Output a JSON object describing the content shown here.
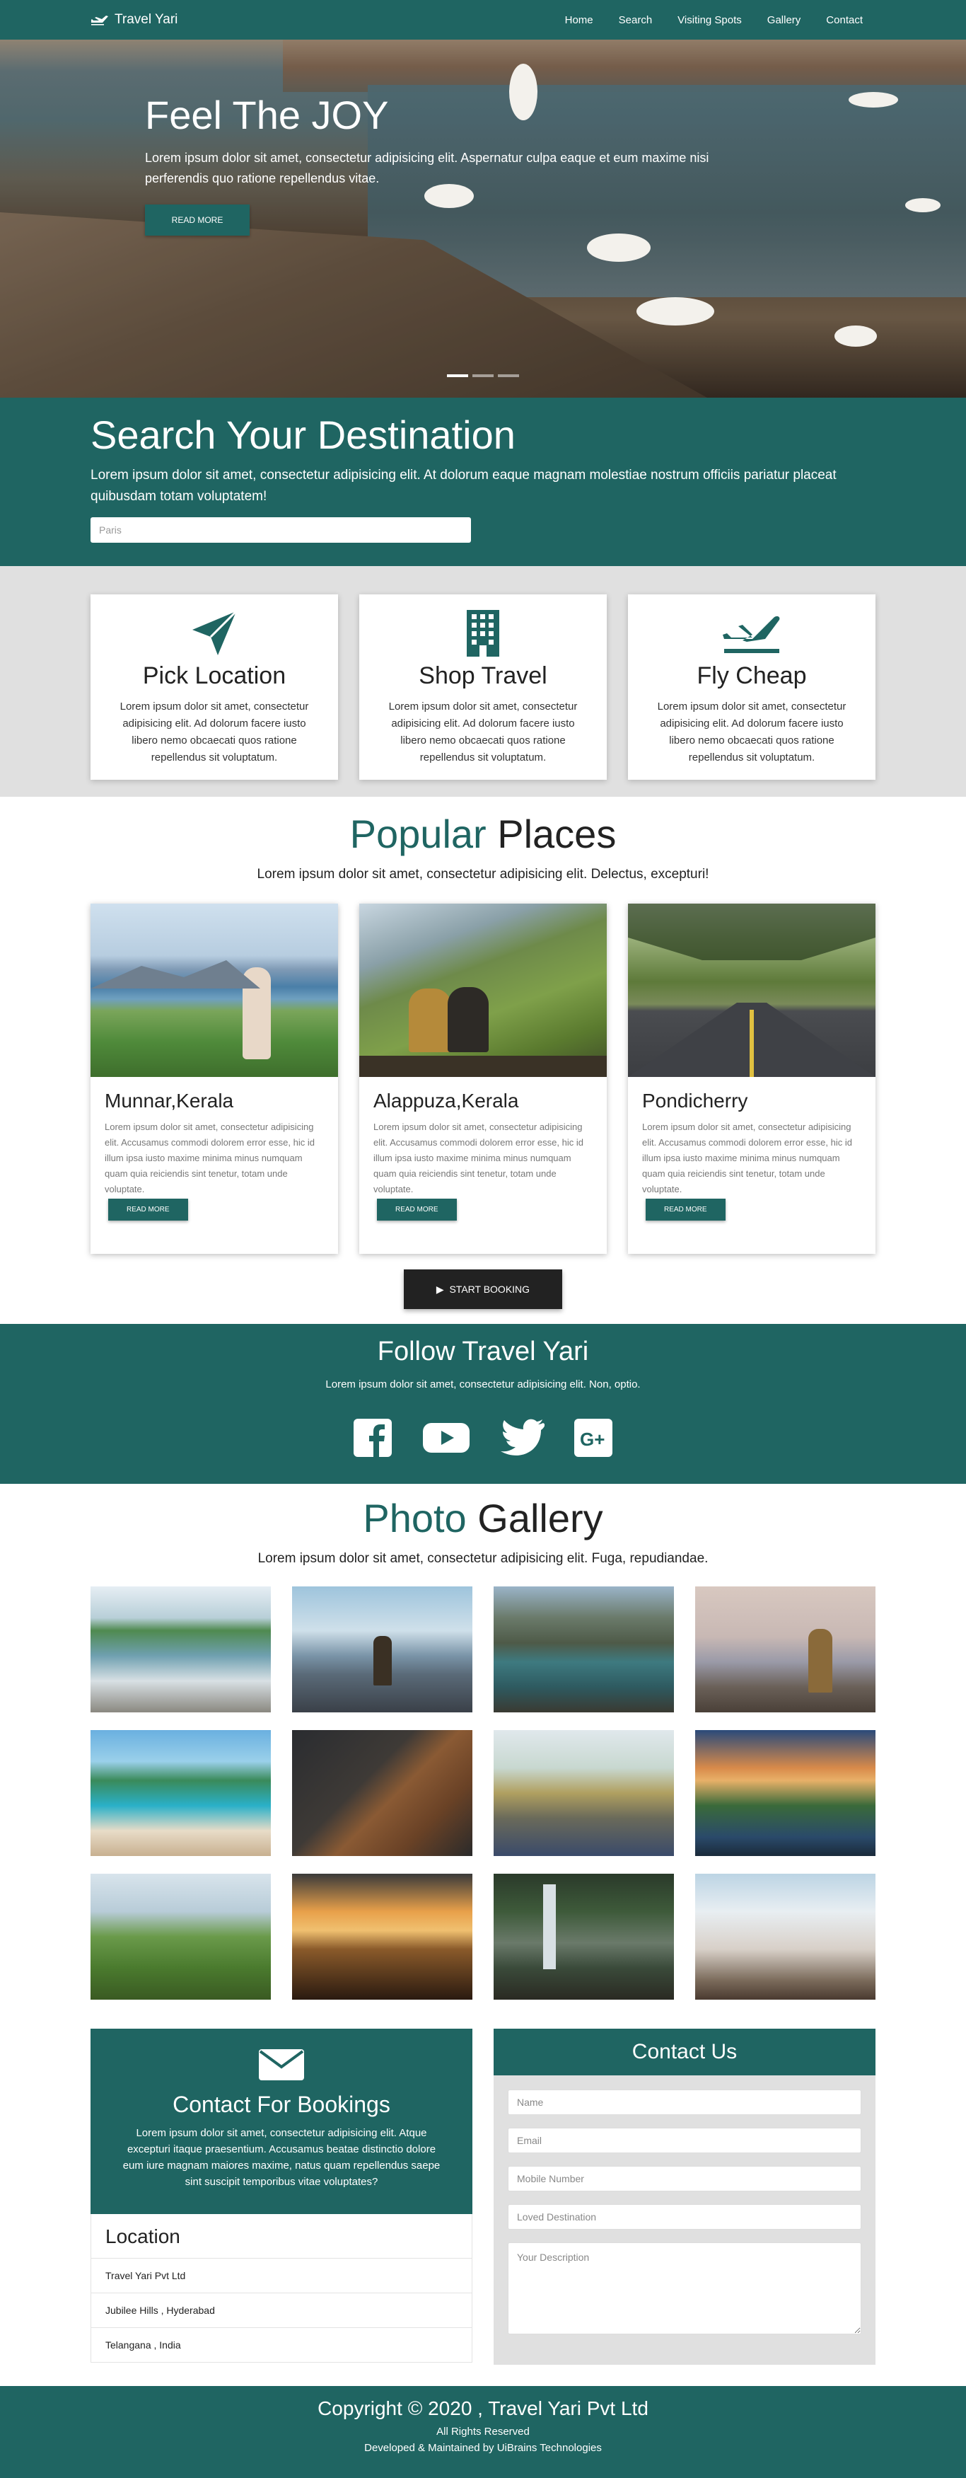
{
  "nav": {
    "brand": "Travel Yari",
    "items": [
      "Home",
      "Search",
      "Visiting Spots",
      "Gallery",
      "Contact"
    ]
  },
  "hero": {
    "title": "Feel The JOY",
    "text": "Lorem ipsum dolor sit amet, consectetur adipisicing elit. Aspernatur culpa eaque et eum maxime nisi perferendis quo ratione repellendus vitae.",
    "button": "READ MORE"
  },
  "search": {
    "title": "Search Your Destination",
    "text": "Lorem ipsum dolor sit amet, consectetur adipisicing elit. At dolorum eaque magnam molestiae nostrum officiis pariatur placeat quibusdam totam voluptatem!",
    "placeholder": "Paris"
  },
  "features": [
    {
      "icon": "paper-plane-icon",
      "title": "Pick Location",
      "text": "Lorem ipsum dolor sit amet, consectetur adipisicing elit. Ad dolorum facere iusto libero nemo obcaecati quos ratione repellendus sit voluptatum."
    },
    {
      "icon": "building-icon",
      "title": "Shop Travel",
      "text": "Lorem ipsum dolor sit amet, consectetur adipisicing elit. Ad dolorum facere iusto libero nemo obcaecati quos ratione repellendus sit voluptatum."
    },
    {
      "icon": "airplane-icon",
      "title": "Fly Cheap",
      "text": "Lorem ipsum dolor sit amet, consectetur adipisicing elit. Ad dolorum facere iusto libero nemo obcaecati quos ratione repellendus sit voluptatum."
    }
  ],
  "popular": {
    "title_accent": "Popular",
    "title_rest": " Places",
    "subtitle": "Lorem ipsum dolor sit amet, consectetur adipisicing elit. Delectus, excepturi!",
    "places": [
      {
        "name": "Munnar,Kerala",
        "text": "Lorem ipsum dolor sit amet, consectetur adipisicing elit. Accusamus commodi dolorem error esse, hic id illum ipsa iusto maxime minima minus numquam quam quia reiciendis sint tenetur, totam unde voluptate.",
        "button": "READ MORE"
      },
      {
        "name": "Alappuza,Kerala",
        "text": "Lorem ipsum dolor sit amet, consectetur adipisicing elit. Accusamus commodi dolorem error esse, hic id illum ipsa iusto maxime minima minus numquam quam quia reiciendis sint tenetur, totam unde voluptate.",
        "button": "READ MORE"
      },
      {
        "name": "Pondicherry",
        "text": "Lorem ipsum dolor sit amet, consectetur adipisicing elit. Accusamus commodi dolorem error esse, hic id illum ipsa iusto maxime minima minus numquam quam quia reiciendis sint tenetur, totam unde voluptate.",
        "button": "READ MORE"
      }
    ],
    "start_button": "START BOOKING"
  },
  "follow": {
    "title": "Follow Travel Yari",
    "text": "Lorem ipsum dolor sit amet, consectetur adipisicing elit. Non, optio.",
    "icons": [
      "facebook-icon",
      "youtube-icon",
      "twitter-icon",
      "google-plus-icon"
    ]
  },
  "gallery": {
    "title_accent": "Photo",
    "title_rest": " Gallery",
    "subtitle": "Lorem ipsum dolor sit amet, consectetur adipisicing elit. Fuga, repudiandae."
  },
  "contact": {
    "bookings_title": "Contact For Bookings",
    "bookings_text": "Lorem ipsum dolor sit amet, consectetur adipisicing elit. Atque excepturi itaque praesentium. Accusamus beatae distinctio dolore eum iure magnam maiores maxime, natus quam repellendus saepe sint suscipit temporibus vitae voluptates?",
    "location_title": "Location",
    "location_lines": [
      "Travel Yari Pvt Ltd",
      "Jubilee Hills , Hyderabad",
      "Telangana , India"
    ],
    "form_title": "Contact Us",
    "placeholders": {
      "name": "Name",
      "email": "Email",
      "mobile": "Mobile Number",
      "destination": "Loved Destination",
      "description": "Your Description"
    }
  },
  "footer": {
    "copyright": "Copyright © 2020 , Travel Yari Pvt Ltd",
    "rights": "All Rights Reserved",
    "developer": "Developed & Maintained by UiBrains Technologies"
  },
  "colors": {
    "brand": "#1f6562",
    "dark": "#222222",
    "light_bg": "#e0e0e0"
  }
}
